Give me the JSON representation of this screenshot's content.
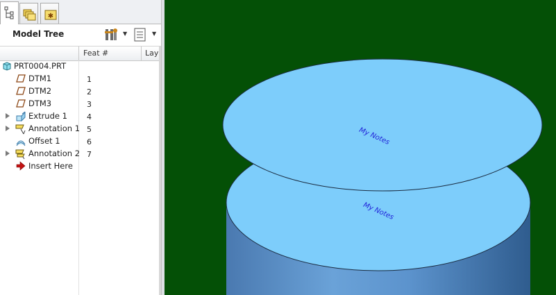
{
  "navigator": {
    "tabs": [
      {
        "name": "model-tree-tab-icon",
        "active": true
      },
      {
        "name": "folder-browser-tab-icon",
        "active": false
      },
      {
        "name": "favorites-tab-icon",
        "active": false
      }
    ],
    "title": "Model Tree",
    "tools": [
      "settings-tools-icon",
      "show-options-icon"
    ],
    "columns": {
      "feat": "Feat #",
      "layer": "Lay"
    }
  },
  "tree": {
    "root": "PRT0004.PRT",
    "items": [
      {
        "label": "DTM1",
        "num": "1",
        "icon": "datum-plane-icon",
        "expandable": false
      },
      {
        "label": "DTM2",
        "num": "2",
        "icon": "datum-plane-icon",
        "expandable": false
      },
      {
        "label": "DTM3",
        "num": "3",
        "icon": "datum-plane-icon",
        "expandable": false
      },
      {
        "label": "Extrude 1",
        "num": "4",
        "icon": "extrude-icon",
        "expandable": true
      },
      {
        "label": "Annotation 1",
        "num": "5",
        "icon": "annotation-icon",
        "expandable": true
      },
      {
        "label": "Offset 1",
        "num": "6",
        "icon": "offset-icon",
        "expandable": false
      },
      {
        "label": "Annotation 2",
        "num": "7",
        "icon": "annotation-icon",
        "expandable": true
      },
      {
        "label": "Insert Here",
        "num": "",
        "icon": "insert-here-icon",
        "expandable": false
      }
    ]
  },
  "graphics": {
    "background": "#045006",
    "surface_color": "#7dcdfb",
    "body_color": "#4f86bf",
    "notes": [
      "My Notes",
      "My Notes"
    ]
  }
}
